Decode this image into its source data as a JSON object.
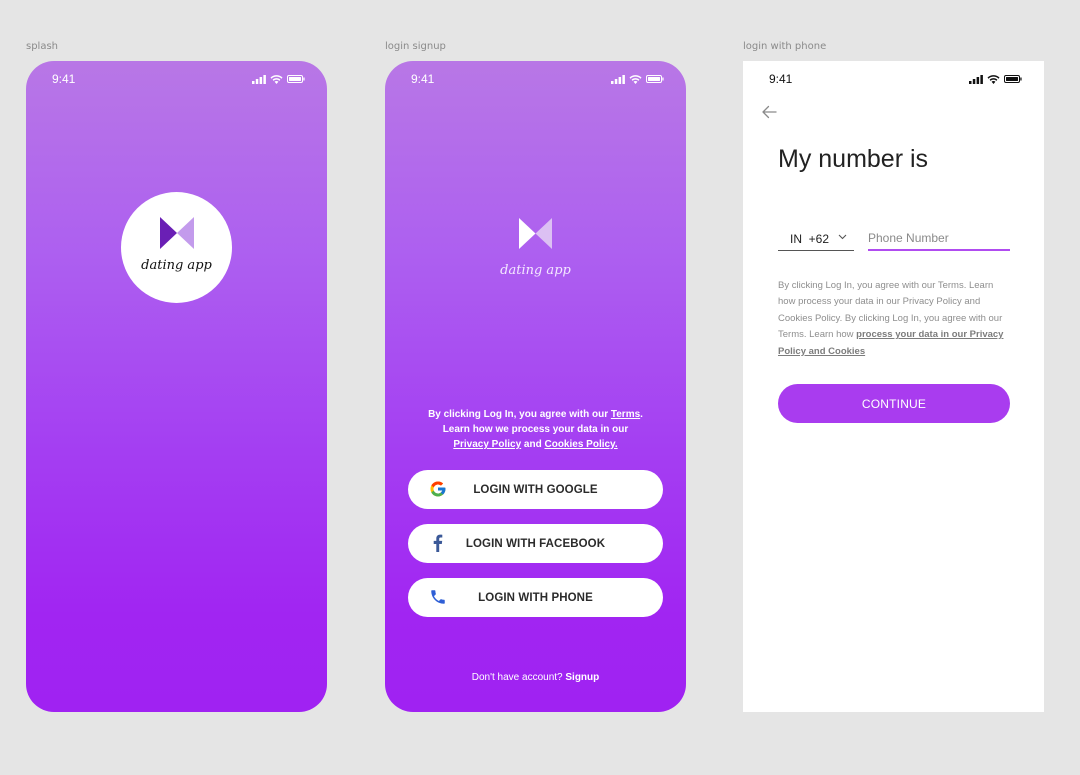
{
  "frames": {
    "splash": {
      "label": "splash"
    },
    "login_signup": {
      "label": "login signup"
    },
    "login_phone": {
      "label": "login with phone"
    }
  },
  "status_bar": {
    "time": "9:41"
  },
  "brand": {
    "name": "dating app"
  },
  "login_signup": {
    "terms": {
      "part1": "By clicking Log In, you agree with our ",
      "terms_link": "Terms",
      "part2": ". Learn how we process your data in our ",
      "privacy_link": "Privacy Policy",
      "part3": " and ",
      "cookies_link": "Cookies Policy."
    },
    "buttons": [
      {
        "label": "LOGIN WITH GOOGLE",
        "icon": "google-icon"
      },
      {
        "label": "LOGIN WITH FACEBOOK",
        "icon": "facebook-icon"
      },
      {
        "label": "LOGIN WITH PHONE",
        "icon": "phone-icon"
      }
    ],
    "signup": {
      "prompt": "Don't have account? ",
      "link": "Signup"
    }
  },
  "login_phone": {
    "title": "My number is",
    "country_code": "IN  +62",
    "phone_placeholder": "Phone Number",
    "terms": {
      "text": "By clicking Log In, you agree with our Terms.  Learn how process your data in our Privacy  Policy and Cookies Policy. By clicking Log In, you agree with our Terms.  Learn how ",
      "link": "process your data in our Privacy  Policy and Cookies"
    },
    "continue_label": "CONTINUE"
  },
  "colors": {
    "accent": "#a93cef",
    "gradient_top": "#b877e6",
    "gradient_bottom": "#a022f2",
    "logo_dark": "#6a1fb5",
    "logo_light": "#c39bec"
  }
}
